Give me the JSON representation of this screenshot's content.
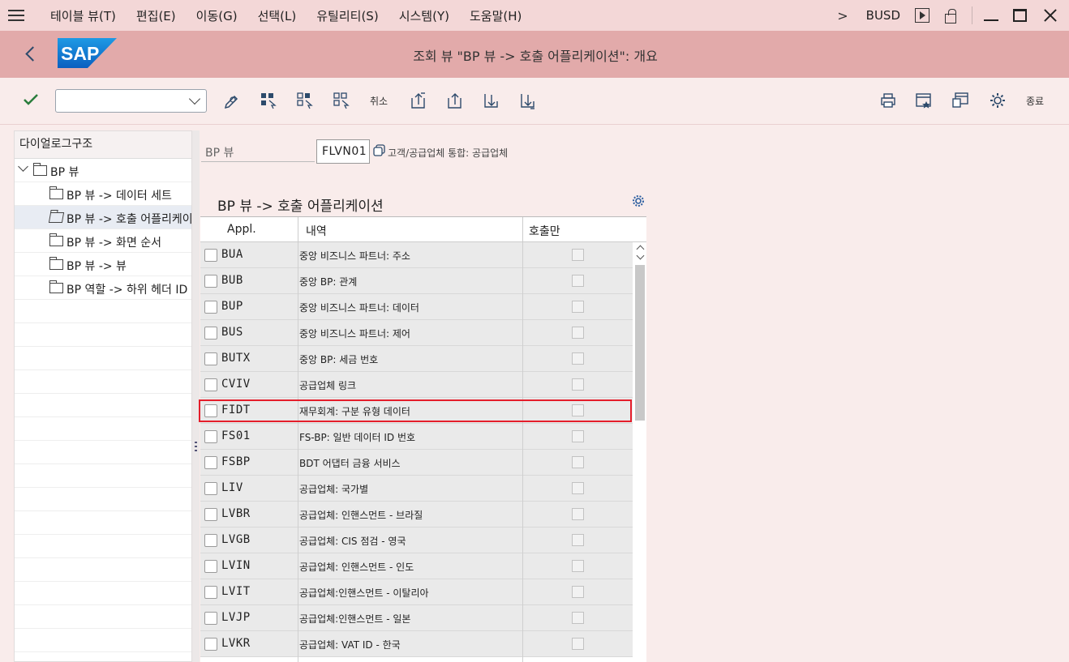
{
  "menubar": {
    "items": [
      "테이블 뷰(T)",
      "편집(E)",
      "이동(G)",
      "선택(L)",
      "유틸리티(S)",
      "시스템(Y)",
      "도움말(H)"
    ],
    "system": "BUSD"
  },
  "header": {
    "logo_text": "SAP",
    "title": "조회 뷰 \"BP 뷰 -> 호출 어플리케이션\": 개요"
  },
  "toolbar": {
    "command_value": "",
    "cancel_label": "취소",
    "exit_label": "종료"
  },
  "tree": {
    "header": "다이얼로그구조",
    "root": "BP 뷰",
    "items": [
      "BP 뷰 -> 데이터 세트",
      "BP 뷰 -> 호출 어플리케이션",
      "BP 뷰 -> 화면 순서",
      "BP 뷰 -> 뷰",
      "BP 역할 -> 하위 헤더 ID"
    ]
  },
  "bp_view": {
    "label": "BP 뷰",
    "value": "FLVN01",
    "description": "고객/공급업체 통합: 공급업체"
  },
  "section": {
    "title": "BP 뷰 -> 호출 어플리케이션"
  },
  "table": {
    "columns": [
      "Appl.",
      "내역",
      "호출만"
    ],
    "rows": [
      {
        "appl": "BUA",
        "desc": "중앙 비즈니스 파트너: 주소"
      },
      {
        "appl": "BUB",
        "desc": "중앙 BP: 관계"
      },
      {
        "appl": "BUP",
        "desc": "중앙 비즈니스 파트너: 데이터"
      },
      {
        "appl": "BUS",
        "desc": "중앙 비즈니스 파트너: 제어"
      },
      {
        "appl": "BUTX",
        "desc": "중앙 BP: 세금 번호"
      },
      {
        "appl": "CVIV",
        "desc": "공급업체 링크"
      },
      {
        "appl": "FIDT",
        "desc": "재무회계: 구분 유형 데이터"
      },
      {
        "appl": "FS01",
        "desc": "FS-BP: 일반 데이터 ID 번호"
      },
      {
        "appl": "FSBP",
        "desc": "BDT 어댑터 금융 서비스"
      },
      {
        "appl": "LIV",
        "desc": "공급업체: 국가별"
      },
      {
        "appl": "LVBR",
        "desc": "공급업체: 인핸스먼트 - 브라질"
      },
      {
        "appl": "LVGB",
        "desc": "공급업체: CIS 점검 - 영국"
      },
      {
        "appl": "LVIN",
        "desc": "공급업체: 인핸스먼트 - 인도"
      },
      {
        "appl": "LVIT",
        "desc": "공급업체:인핸스먼트 - 이탈리아"
      },
      {
        "appl": "LVJP",
        "desc": "공급업체:인핸스먼트 - 일본"
      },
      {
        "appl": "LVKR",
        "desc": "공급업체: VAT ID - 한국"
      }
    ]
  },
  "colors": {
    "menubar_bg": "#f3d7d7",
    "header_bg": "#e2aaaa",
    "highlight": "#e41e2b",
    "sap_blue": "#0a6ed1"
  }
}
